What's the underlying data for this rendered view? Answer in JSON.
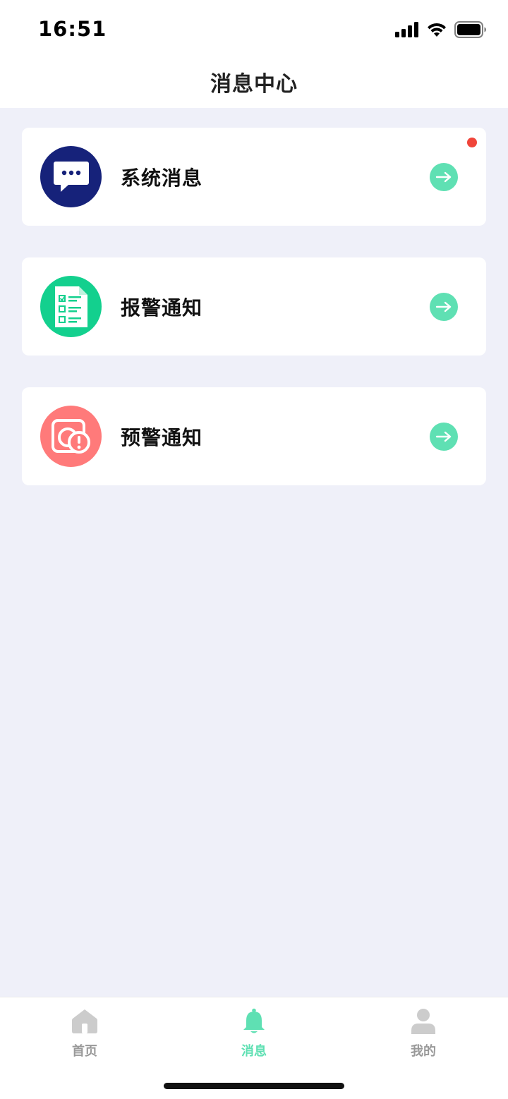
{
  "status_bar": {
    "time": "16:51"
  },
  "header": {
    "title": "消息中心"
  },
  "messages": [
    {
      "label": "系统消息",
      "icon": "chat-bubble-icon",
      "icon_bg": "#16227a",
      "has_unread": true
    },
    {
      "label": "报警通知",
      "icon": "checklist-document-icon",
      "icon_bg": "#13d08e",
      "has_unread": false
    },
    {
      "label": "预警通知",
      "icon": "camera-warning-icon",
      "icon_bg": "#ff7a7a",
      "has_unread": false
    }
  ],
  "colors": {
    "accent": "#5fe0b3",
    "badge": "#f0453a",
    "background": "#eff0f9"
  },
  "tab_bar": {
    "tabs": [
      {
        "label": "首页",
        "icon": "home-icon",
        "active": false
      },
      {
        "label": "消息",
        "icon": "bell-icon",
        "active": true
      },
      {
        "label": "我的",
        "icon": "person-icon",
        "active": false
      }
    ]
  }
}
